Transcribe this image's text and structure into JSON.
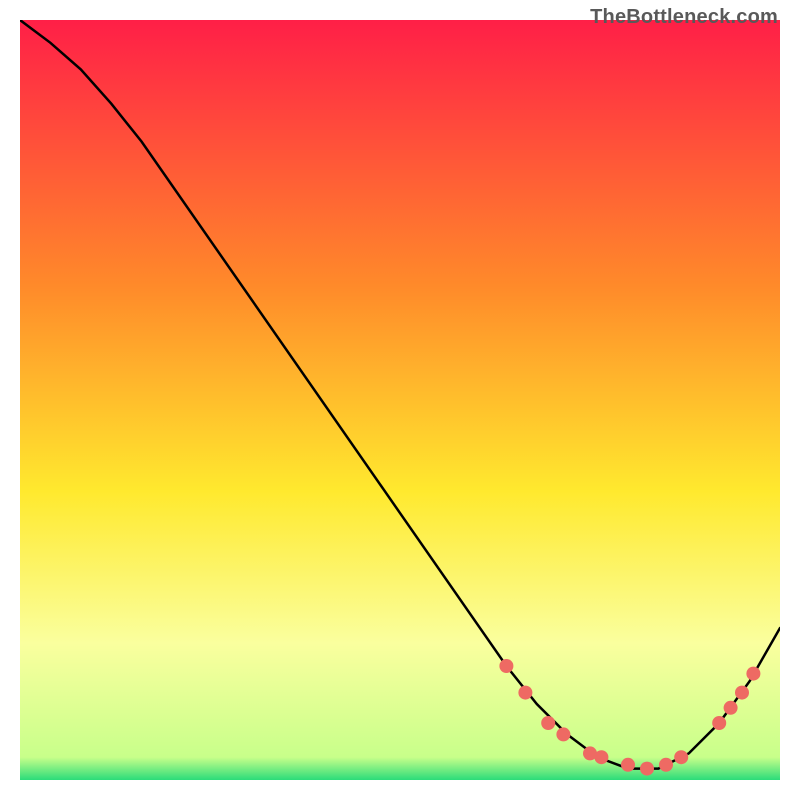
{
  "watermark": "TheBottleneck.com",
  "colors": {
    "gradient_top": "#ff1f47",
    "gradient_mid1": "#ff8a2a",
    "gradient_mid2": "#ffe92e",
    "gradient_low": "#faff9e",
    "gradient_bottom": "#2bdc7a",
    "curve": "#000000",
    "marker": "#ee6a63"
  },
  "chart_data": {
    "type": "line",
    "title": "",
    "xlabel": "",
    "ylabel": "",
    "xlim": [
      0,
      100
    ],
    "ylim": [
      0,
      100
    ],
    "series": [
      {
        "name": "curve",
        "x": [
          0,
          4,
          8,
          12,
          16,
          64,
          68,
          72,
          76,
          80,
          84,
          88,
          92,
          96,
          100
        ],
        "y": [
          100,
          97,
          93.5,
          89,
          84,
          15,
          10,
          6,
          3,
          1.5,
          1.5,
          3.5,
          7.5,
          13,
          20
        ]
      }
    ],
    "markers": [
      {
        "x": 64,
        "y": 15
      },
      {
        "x": 66.5,
        "y": 11.5
      },
      {
        "x": 69.5,
        "y": 7.5
      },
      {
        "x": 71.5,
        "y": 6
      },
      {
        "x": 75,
        "y": 3.5
      },
      {
        "x": 76.5,
        "y": 3
      },
      {
        "x": 80,
        "y": 2
      },
      {
        "x": 82.5,
        "y": 1.5
      },
      {
        "x": 85,
        "y": 2
      },
      {
        "x": 87,
        "y": 3
      },
      {
        "x": 92,
        "y": 7.5
      },
      {
        "x": 93.5,
        "y": 9.5
      },
      {
        "x": 95,
        "y": 11.5
      },
      {
        "x": 96.5,
        "y": 14
      }
    ]
  }
}
